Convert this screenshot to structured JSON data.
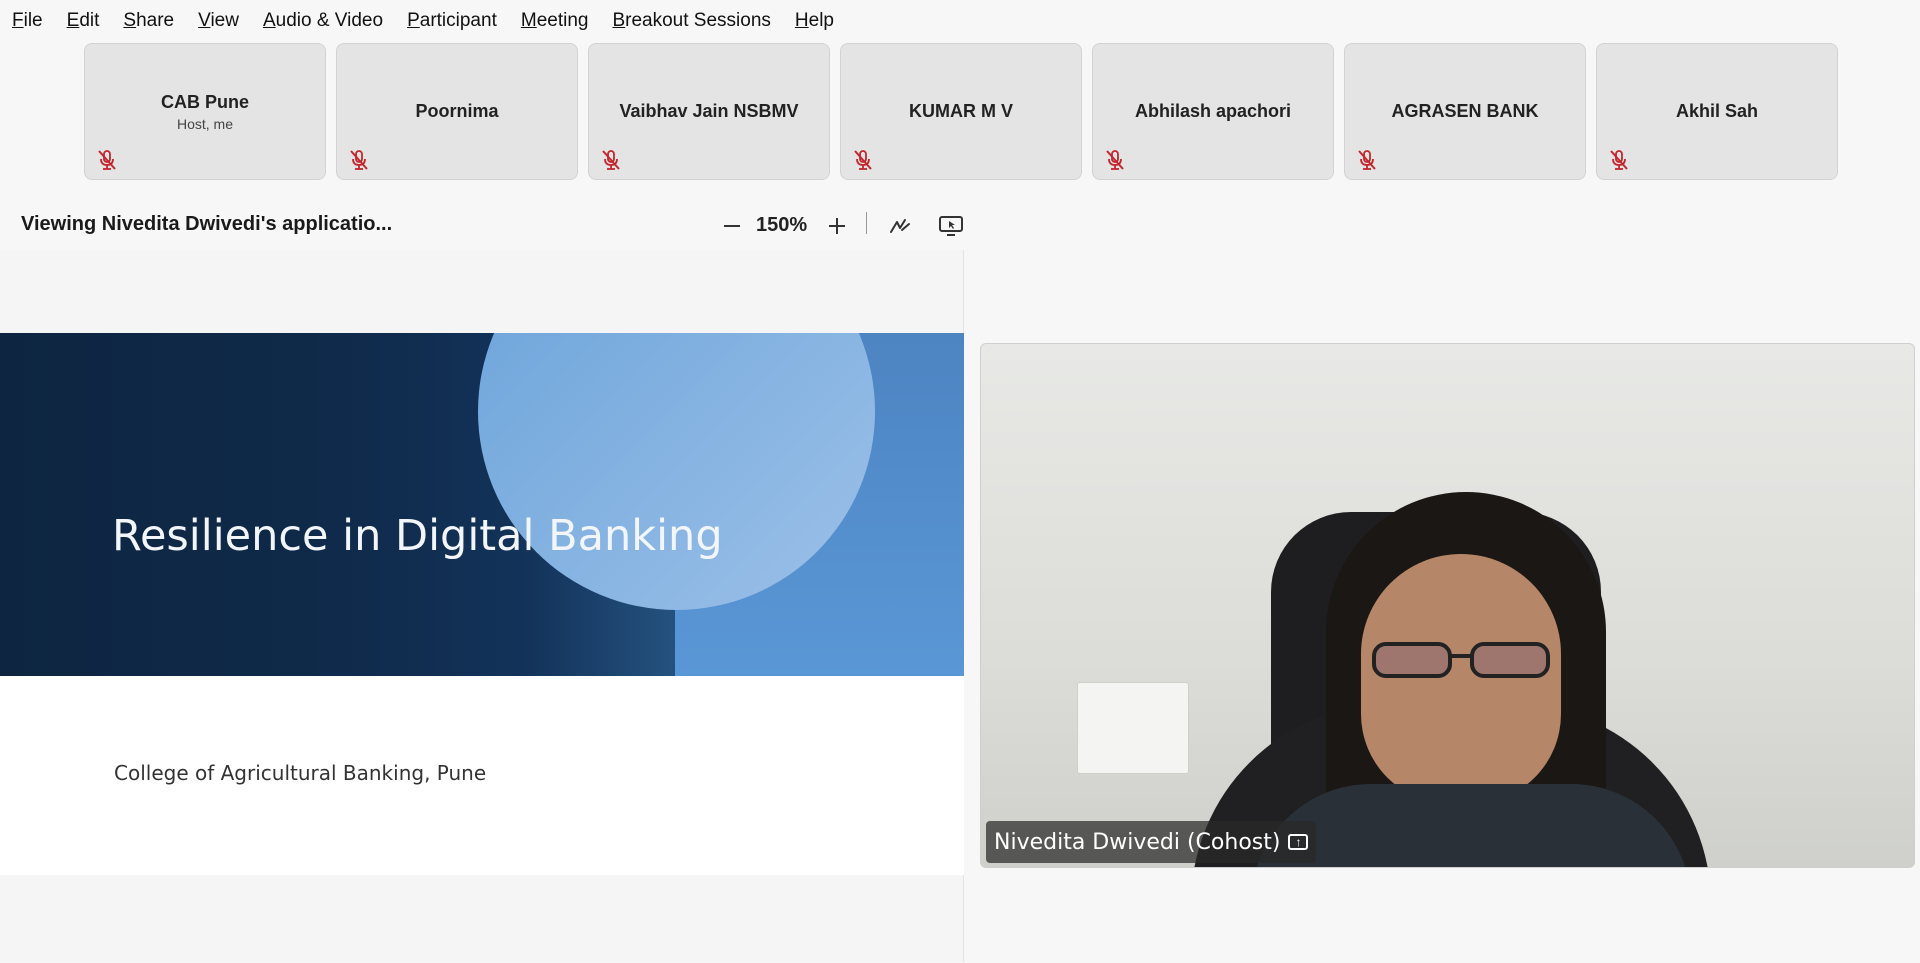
{
  "menubar": {
    "items": [
      {
        "label": "File",
        "accel": "F"
      },
      {
        "label": "Edit",
        "accel": "E"
      },
      {
        "label": "Share",
        "accel": "S"
      },
      {
        "label": "View",
        "accel": "V"
      },
      {
        "label": "Audio & Video",
        "accel": "A"
      },
      {
        "label": "Participant",
        "accel": "P"
      },
      {
        "label": "Meeting",
        "accel": "M"
      },
      {
        "label": "Breakout Sessions",
        "accel": "B"
      },
      {
        "label": "Help",
        "accel": "H"
      }
    ]
  },
  "participants": [
    {
      "name": "CAB Pune",
      "sub": "Host, me",
      "muted": true
    },
    {
      "name": "Poornima",
      "sub": "",
      "muted": true
    },
    {
      "name": "Vaibhav Jain NSBMV",
      "sub": "",
      "muted": true
    },
    {
      "name": "KUMAR M V",
      "sub": "",
      "muted": true
    },
    {
      "name": "Abhilash apachori",
      "sub": "",
      "muted": true
    },
    {
      "name": "AGRASEN BANK",
      "sub": "",
      "muted": true
    },
    {
      "name": "Akhil Sah",
      "sub": "",
      "muted": true
    }
  ],
  "sharebar": {
    "title": "Viewing Nivedita Dwivedi's applicatio...",
    "zoom": "150%",
    "zoom_out_icon": "minus-icon",
    "zoom_in_icon": "plus-icon",
    "annotate_icon": "annotate-pen-icon",
    "remote_control_icon": "remote-control-icon"
  },
  "slide": {
    "title": "Resilience in Digital Banking",
    "subtitle": "College of Agricultural Banking, Pune"
  },
  "video": {
    "name": "Nivedita Dwivedi (Cohost)",
    "sharing_icon": "screen-share-icon"
  },
  "colors": {
    "mute_red": "#c4262e",
    "tile_bg": "#e4e4e4",
    "slide_dark": "#0f2a4a",
    "slide_blue": "#5a97d6"
  }
}
